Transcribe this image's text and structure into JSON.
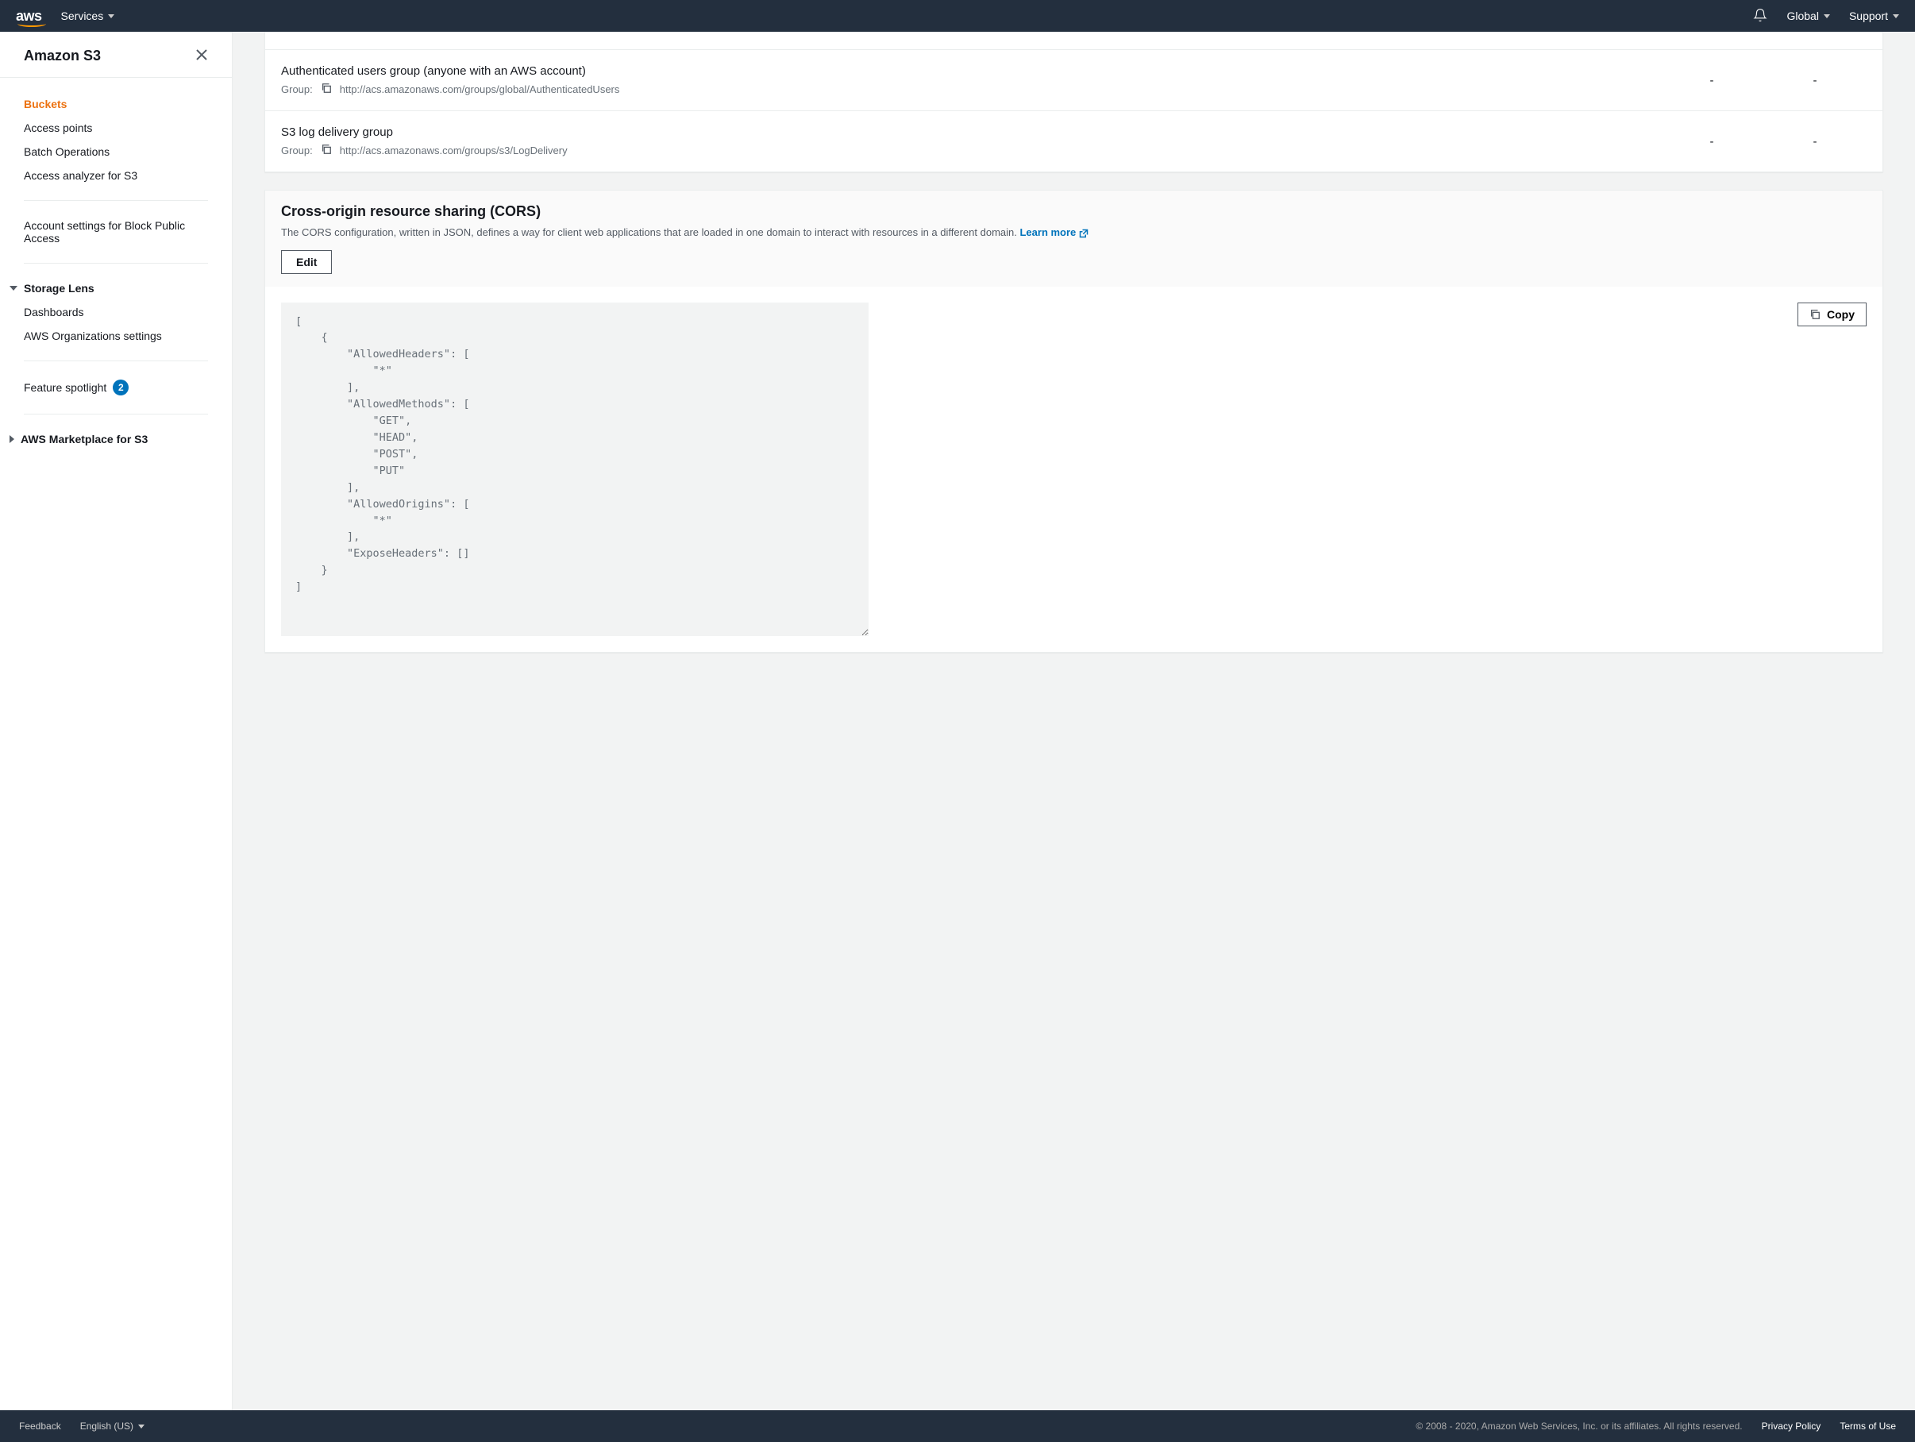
{
  "topnav": {
    "logo_text": "aws",
    "services": "Services",
    "global": "Global",
    "support": "Support"
  },
  "sidebar": {
    "title": "Amazon S3",
    "items": [
      {
        "label": "Buckets",
        "active": true
      },
      {
        "label": "Access points"
      },
      {
        "label": "Batch Operations"
      },
      {
        "label": "Access analyzer for S3"
      }
    ],
    "block_access": "Account settings for Block Public Access",
    "storage_lens": {
      "header": "Storage Lens",
      "dashboards": "Dashboards",
      "org_settings": "AWS Organizations settings"
    },
    "feature_spotlight": "Feature spotlight",
    "feature_spotlight_badge": "2",
    "marketplace": "AWS Marketplace for S3"
  },
  "acl": {
    "rows": [
      {
        "title": "Authenticated users group (anyone with an AWS account)",
        "group_label": "Group:",
        "group_url": "http://acs.amazonaws.com/groups/global/AuthenticatedUsers",
        "col1": "-",
        "col2": "-"
      },
      {
        "title": "S3 log delivery group",
        "group_label": "Group:",
        "group_url": "http://acs.amazonaws.com/groups/s3/LogDelivery",
        "col1": "-",
        "col2": "-"
      }
    ]
  },
  "cors": {
    "title": "Cross-origin resource sharing (CORS)",
    "description": "The CORS configuration, written in JSON, defines a way for client web applications that are loaded in one domain to interact with resources in a different domain. ",
    "learn_more": "Learn more",
    "edit": "Edit",
    "copy": "Copy",
    "config_json": "[\n    {\n        \"AllowedHeaders\": [\n            \"*\"\n        ],\n        \"AllowedMethods\": [\n            \"GET\",\n            \"HEAD\",\n            \"POST\",\n            \"PUT\"\n        ],\n        \"AllowedOrigins\": [\n            \"*\"\n        ],\n        \"ExposeHeaders\": []\n    }\n]"
  },
  "footer": {
    "feedback": "Feedback",
    "language": "English (US)",
    "copyright": "© 2008 - 2020, Amazon Web Services, Inc. or its affiliates. All rights reserved.",
    "privacy": "Privacy Policy",
    "terms": "Terms of Use"
  }
}
